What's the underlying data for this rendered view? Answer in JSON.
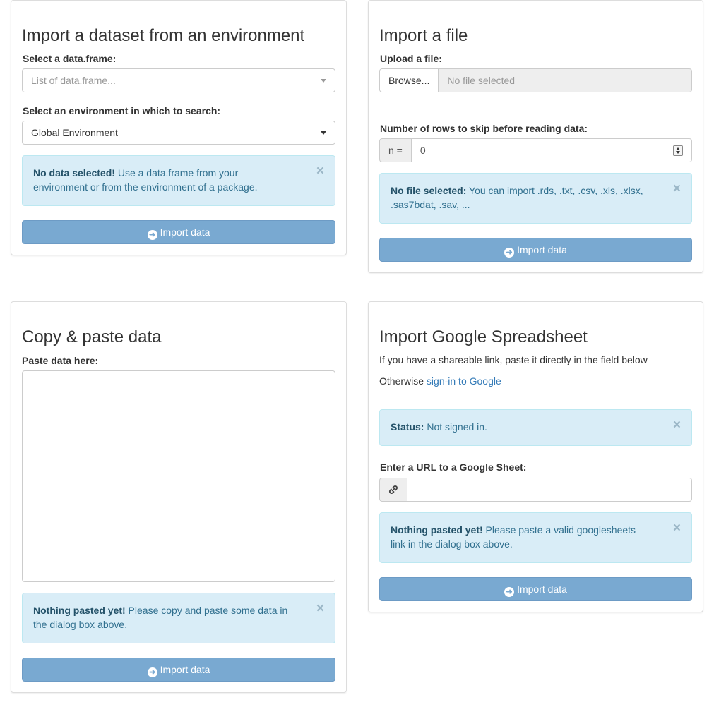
{
  "env_panel": {
    "title": "Import a dataset from an environment",
    "df_label": "Select a data.frame:",
    "df_placeholder": "List of data.frame...",
    "env_label": "Select an environment in which to search:",
    "env_value": "Global Environment",
    "alert_strong": "No data selected!",
    "alert_text_1": " Use a data.frame from your",
    "alert_text_2": "environment or from the environment of a package.",
    "alert_close": "×",
    "import_label": "Import data"
  },
  "file_panel": {
    "title": "Import a file",
    "upload_label": "Upload a file:",
    "browse_label": "Browse...",
    "file_value": "No file selected",
    "skip_label": "Number of rows to skip before reading data:",
    "skip_addon": "n =",
    "skip_value": "0",
    "alert_strong": "No file selected:",
    "alert_text_1": " You can import .rds, .txt, .csv, .xls, .xlsx,",
    "alert_text_2": ".sas7bdat, .sav, ...",
    "alert_close": "×",
    "import_label": "Import data"
  },
  "copy_panel": {
    "title": "Copy & paste data",
    "paste_label": "Paste data here:",
    "paste_value": "",
    "alert_strong": "Nothing pasted yet!",
    "alert_text_1": " Please copy and paste some data in",
    "alert_text_2": "the dialog box above.",
    "alert_close": "×",
    "import_label": "Import data"
  },
  "gs_panel": {
    "title": "Import Google Spreadsheet",
    "hint_text": "If you have a shareable link, paste it directly in the field below",
    "otherwise_text": "Otherwise ",
    "signin_link": "sign-in to Google",
    "status_strong": "Status:",
    "status_text": " Not signed in.",
    "status_close": "×",
    "url_label": "Enter a URL to a Google Sheet:",
    "url_value": "",
    "alert_strong": "Nothing pasted yet!",
    "alert_text_1": " Please paste a valid googlesheets",
    "alert_text_2": "link in the dialog box above.",
    "alert_close": "×",
    "import_label": "Import data"
  },
  "icons": {
    "import": "arrow-circle-right-icon",
    "link": "link-icon",
    "dropdown": "caret-down-icon",
    "close": "close-icon"
  },
  "colors": {
    "primary_button": "#79a9d1",
    "alert_bg": "#d9edf7",
    "alert_text": "#31708f",
    "link": "#337ab7"
  }
}
